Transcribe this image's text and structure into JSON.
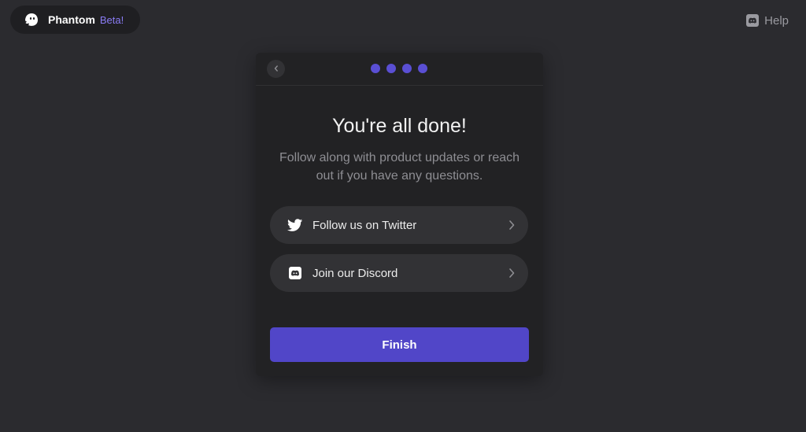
{
  "brand": {
    "name": "Phantom",
    "badge": "Beta!",
    "icon": "phantom-ghost-icon"
  },
  "header": {
    "help_label": "Help",
    "help_icon": "discord-icon"
  },
  "card": {
    "back_icon": "chevron-left-icon",
    "steps_total": 4,
    "steps_completed": 4,
    "title": "You're all done!",
    "subtitle": "Follow along with product updates or reach out if you have any questions.",
    "links": [
      {
        "label": "Follow us on Twitter",
        "icon": "twitter-icon"
      },
      {
        "label": "Join our Discord",
        "icon": "discord-icon"
      }
    ],
    "finish_label": "Finish"
  },
  "colors": {
    "background": "#2b2b2f",
    "card": "#222224",
    "row": "#323235",
    "accent": "#5146c8",
    "beta": "#8a7cf5",
    "muted_text": "#8e8e93"
  }
}
